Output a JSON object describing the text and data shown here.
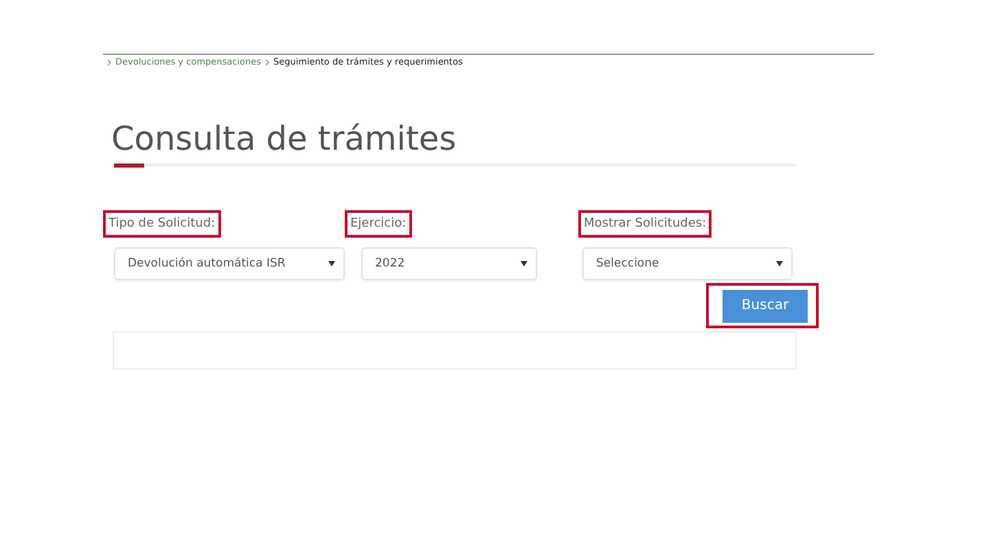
{
  "breadcrumb": [
    {
      "label": "Devoluciones y compensaciones",
      "link": true
    },
    {
      "label": "Seguimiento de trámites y requerimientos",
      "link": false
    }
  ],
  "title": "Consulta de trámites",
  "filters": [
    {
      "label": "Tipo de Solicitud:",
      "value": "Devolución automática ISR",
      "highlighted": true
    },
    {
      "label": "Ejercicio:",
      "value": "2022",
      "highlighted": true
    },
    {
      "label": "Mostrar Solicitudes:",
      "value": "Seleccione",
      "highlighted": true
    }
  ],
  "search_button": {
    "label": "Buscar",
    "highlighted": true
  }
}
